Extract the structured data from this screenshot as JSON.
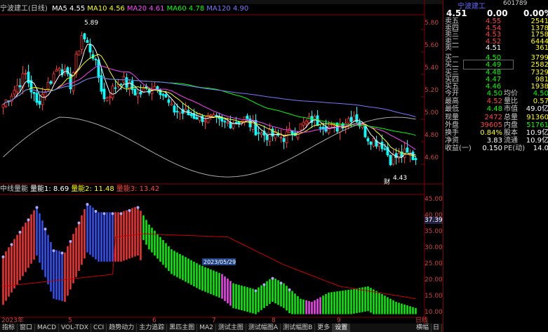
{
  "stock": {
    "name": "宁波建工(日线)",
    "code": "601789",
    "short_title": "宁波建工",
    "price": "4.51",
    "change": "0.00",
    "pct": "0.00%"
  },
  "ma_legend": [
    {
      "label": "MA5",
      "value": "4.55",
      "color": "#ffffff"
    },
    {
      "label": "MA10",
      "value": "4.56",
      "color": "#ffff00"
    },
    {
      "label": "MA20",
      "value": "4.61",
      "color": "#ff44ff"
    },
    {
      "label": "MA60",
      "value": "4.78",
      "color": "#00ff00"
    },
    {
      "label": "MA120",
      "value": "4.90",
      "color": "#7777ff"
    }
  ],
  "indicator_legend": [
    {
      "label": "中线量能",
      "value": "",
      "color": "#ccc"
    },
    {
      "label": "量能1:",
      "value": "8.69",
      "color": "#ffffff"
    },
    {
      "label": "量能2:",
      "value": "11.48",
      "color": "#ffff00"
    },
    {
      "label": "量能3:",
      "value": "13.42",
      "color": "#ff4444"
    }
  ],
  "price_axis": [
    "5.80",
    "5.60",
    "5.40",
    "5.20",
    "5.00",
    "4.80",
    "4.60"
  ],
  "ind_axis": [
    "45.00",
    "40.00",
    "35.00",
    "30.00",
    "25.00",
    "20.00",
    "15.00",
    "10.00"
  ],
  "ind_highlight": "37.39",
  "annotations": {
    "high": "5.89",
    "low": "4.43",
    "low_marker": "财"
  },
  "date_label": "2023/05/29",
  "month_labels": [
    "2023年",
    "5",
    "6",
    "7",
    "8",
    "9",
    "日线"
  ],
  "order_book": {
    "sell": [
      {
        "label": "卖五",
        "price": "4.55",
        "vol": "2541"
      },
      {
        "label": "卖四",
        "price": "4.54",
        "vol": "1378"
      },
      {
        "label": "卖三",
        "price": "4.53",
        "vol": "1758"
      },
      {
        "label": "卖二",
        "price": "4.52",
        "vol": "6444"
      },
      {
        "label": "卖一",
        "price": "4.51",
        "vol": "361"
      }
    ],
    "buy": [
      {
        "label": "买一",
        "price": "4.50",
        "vol": "3799"
      },
      {
        "label": "买二",
        "price": "4.49",
        "vol": "2582"
      },
      {
        "label": "买三",
        "price": "4.48",
        "vol": "7329"
      },
      {
        "label": "买四",
        "price": "4.47",
        "vol": "981"
      },
      {
        "label": "买五",
        "price": "4.46",
        "vol": "1938"
      }
    ]
  },
  "stats": [
    {
      "l1": "今开",
      "v1": "4.50",
      "l2": "均价",
      "v2": "4.50",
      "c1": "#00ff00",
      "c2": "#00ff00"
    },
    {
      "l1": "最高",
      "v1": "4.52",
      "l2": "量比",
      "v2": "0.57",
      "c1": "#ff4444",
      "c2": "#ffff00"
    },
    {
      "l1": "最低",
      "v1": "4.48",
      "l2": "市值",
      "v2": "49.0亿",
      "c1": "#00ff00",
      "c2": "#ffffff"
    },
    {
      "l1": "现量",
      "v1": "2472",
      "l2": "总量",
      "v2": "91360",
      "c1": "#ff4444",
      "c2": "#ffff00"
    },
    {
      "l1": "外盘",
      "v1": "39605",
      "l2": "内盘",
      "v2": "51761",
      "c1": "#ff4444",
      "c2": "#00ff00"
    },
    {
      "l1": "换手",
      "v1": "0.84%",
      "l2": "股本",
      "v2": "10.9亿",
      "c1": "#ffff00",
      "c2": "#ffffff"
    },
    {
      "l1": "净资",
      "v1": "3.83",
      "l2": "流通",
      "v2": "10.9亿",
      "c1": "#ffffff",
      "c2": "#ffffff"
    },
    {
      "l1": "收益(一)",
      "v1": "0.150",
      "l2": "PE(动)",
      "v2": "14.0",
      "c1": "#ffffff",
      "c2": "#ffffff"
    }
  ],
  "bottom_tabs": [
    "指标",
    "窗口",
    "MACD",
    "VOL-TDX",
    "CCI",
    "趋势动力",
    "主力追踪",
    "黑匹主图",
    "MA2",
    "测试主图",
    "测试幅图A",
    "测试幅图B",
    "更多",
    "设置"
  ],
  "bottom_right": [
    "横幅",
    "日"
  ],
  "colors": {
    "up": "#ff3333",
    "down": "#00ffff",
    "bg": "#000000",
    "axis": "#aa0000"
  }
}
